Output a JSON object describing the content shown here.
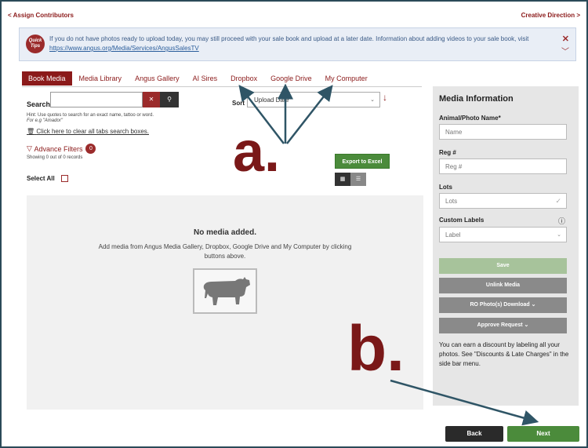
{
  "topnav": {
    "back_link": "< Assign Contributors",
    "forward_link": "Creative Direction >"
  },
  "tips": {
    "icon_text": "Quick Tips",
    "text": "If you do not have photos ready to upload today, you may still proceed with your sale book and upload at a later date. Information about adding videos to your sale book, visit",
    "link": "https://www.angus.org/Media/Services/AngusSalesTV",
    "close": "✕",
    "chevron": "﹀"
  },
  "tabs": [
    {
      "label": "Book Media"
    },
    {
      "label": "Media Library"
    },
    {
      "label": "Angus Gallery"
    },
    {
      "label": "AI Sires"
    },
    {
      "label": "Dropbox"
    },
    {
      "label": "Google Drive"
    },
    {
      "label": "My Computer"
    }
  ],
  "search": {
    "label": "Search",
    "placeholder": "",
    "clear_icon": "✕",
    "go_icon": "⚲",
    "hint": "Hint: Use quotes to search for an exact name, tattoo or word.",
    "hint_example": "For e.g \"Amador\"",
    "clear_tabs": "Click here to clear all tabs search boxes."
  },
  "filters": {
    "label": "Advance Filters",
    "count": "0"
  },
  "showing": "Showing 0 out of 0 records",
  "select_all": "Select All",
  "sort": {
    "label": "Sort",
    "value": "Upload Date",
    "caret": "⌄",
    "direction_icon": "↓"
  },
  "export_label": "Export to Excel",
  "view_toggle": {
    "grid": "▦",
    "list": "☰"
  },
  "media": {
    "empty_title": "No media added.",
    "empty_text": "Add media from Angus Media Gallery, Dropbox, Google Drive and My Computer by clicking buttons above."
  },
  "side": {
    "title": "Media Information",
    "name_label": "Animal/Photo Name*",
    "name_placeholder": "Name",
    "reg_label": "Reg #",
    "reg_placeholder": "Reg #",
    "lots_label": "Lots",
    "lots_placeholder": "Lots",
    "custom_label": "Custom Labels",
    "custom_placeholder": "Label",
    "info_icon": "ⓘ",
    "save": "Save",
    "unlink": "Unlink Media",
    "ro_download": "RO Photo(s) Download ⌄",
    "approve": "Approve Request ⌄",
    "note": "You can earn a discount by labeling all your photos. See \"Discounts & Late Charges\" in the side bar menu."
  },
  "footer": {
    "back": "Back",
    "next": "Next"
  },
  "annotations": {
    "a": "a.",
    "b": "b."
  },
  "colors": {
    "brand": "#8b1a1a",
    "green": "#4b8b3b",
    "annotation": "#7a1818",
    "arrow": "#2f5566"
  }
}
